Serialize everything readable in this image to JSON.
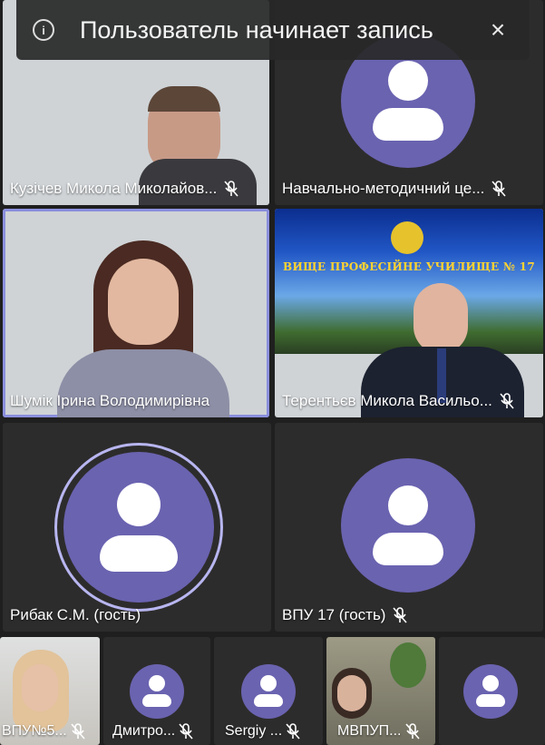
{
  "toast": {
    "info_icon": "i",
    "message": "Пользователь начинает запись",
    "close_icon": "×"
  },
  "participants": {
    "p1": "Кузічев Микола Миколайов...",
    "p2": "Навчально-методичний це...",
    "p3": "Шумік Ірина Володимирівна",
    "p4": "Терентьєв Микола Васильо...",
    "p5": "Рибак С.М. (гость)",
    "p6": "ВПУ 17 (гость)",
    "p7": "ВПУ№5...",
    "p8": "Дмитро...",
    "p9": "Sergiy ...",
    "p10": "МВПУП..."
  },
  "slide": {
    "title": "ВИЩЕ ПРОФЕСІЙНЕ УЧИЛИЩЕ № 17"
  },
  "colors": {
    "avatar": "#6a63b0",
    "active_border": "#8b8fde",
    "tile_bg": "#2d2c2c"
  }
}
